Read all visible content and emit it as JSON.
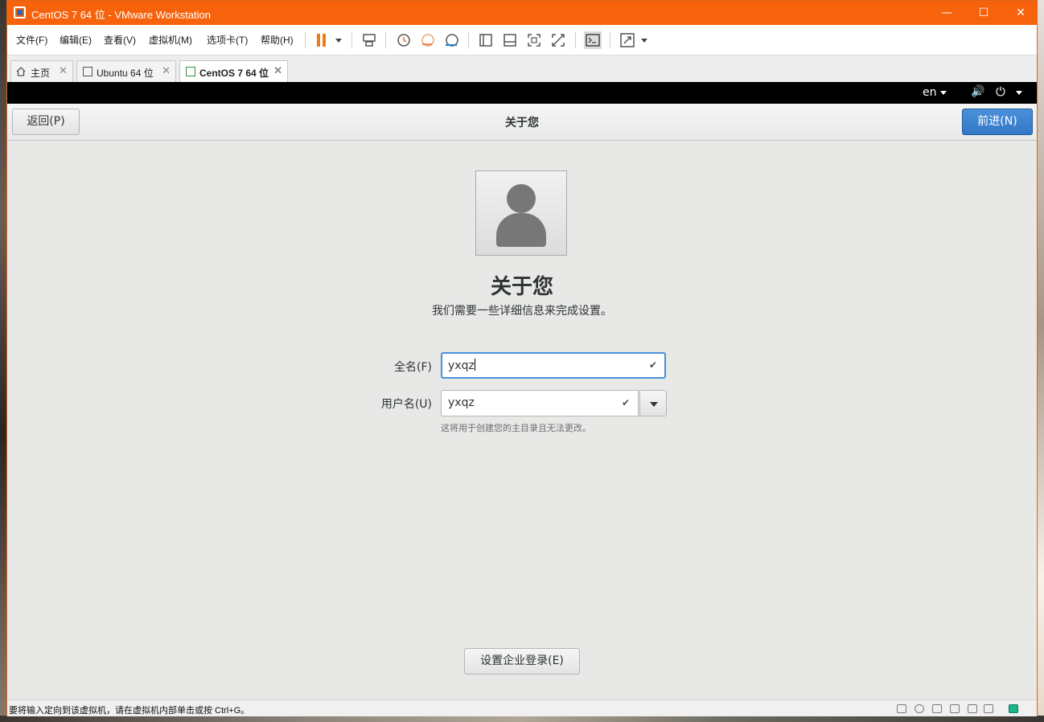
{
  "window": {
    "title": "CentOS 7 64 位 - VMware Workstation",
    "controls": {
      "minimize": "—",
      "maximize": "☐",
      "close": "✕"
    }
  },
  "menu": [
    "文件(F)",
    "编辑(E)",
    "查看(V)",
    "虚拟机(M)",
    "选项卡(T)",
    "帮助(H)"
  ],
  "tabs": [
    {
      "label": "主页",
      "icon": "home-icon"
    },
    {
      "label": "Ubuntu 64 位",
      "icon": "vm-icon"
    },
    {
      "label": "CentOS 7 64 位",
      "icon": "vm-running-icon",
      "active": true
    }
  ],
  "guest_panel": {
    "language": "en",
    "volume_icon": "🔊",
    "power_icon": "⏻"
  },
  "header": {
    "back": "返回(P)",
    "title": "关于您",
    "next": "前进(N)"
  },
  "content": {
    "title": "关于您",
    "subtitle": "我们需要一些详细信息来完成设置。",
    "full_name_label": "全名(F)",
    "full_name_value": "yxqz",
    "username_label": "用户名(U)",
    "username_value": "yxqz",
    "check_glyph": "✔",
    "hint": "这将用于创建您的主目录且无法更改。",
    "enterprise_button": "设置企业登录(E)"
  },
  "statusbar": {
    "message": "要将输入定向到该虚拟机，请在虚拟机内部单击或按 Ctrl+G。"
  },
  "colors": {
    "titlebar": "#f7630c",
    "accent": "#4a90d9"
  }
}
